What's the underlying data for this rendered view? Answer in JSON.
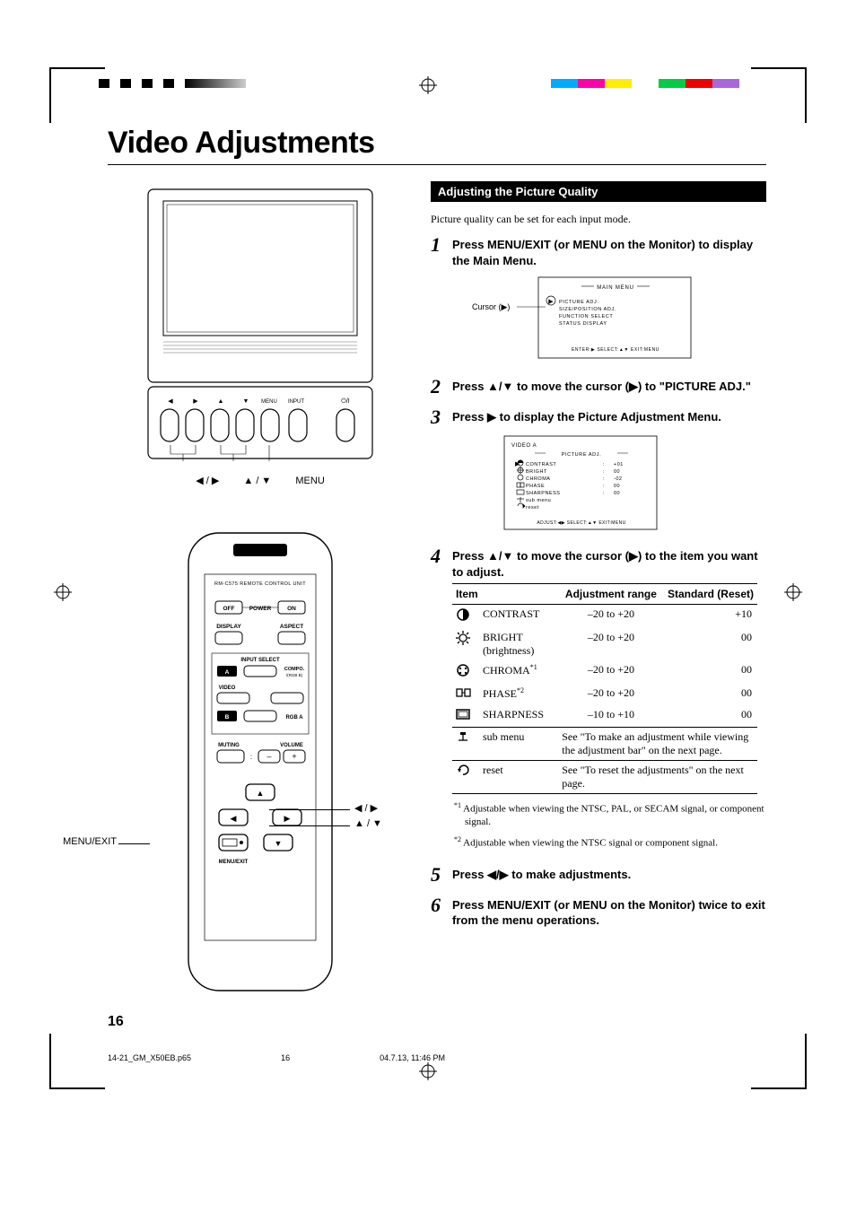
{
  "title": "Video Adjustments",
  "page_number": "16",
  "section_header": "Adjusting the Picture Quality",
  "intro": "Picture quality can be set for each input mode.",
  "monitor_button_row": [
    "◀",
    "▶",
    "▲",
    "▼",
    "MENU",
    "INPUT",
    "⏻/I"
  ],
  "monitor_labels": {
    "lr": "◀ / ▶",
    "ud": "▲ / ▼",
    "menu": "MENU"
  },
  "remote": {
    "model": "RM-C575 REMOTE CONTROL UNIT",
    "rows": {
      "power": [
        "OFF",
        "POWER",
        "ON"
      ],
      "disp": [
        "DISPLAY",
        "",
        "ASPECT"
      ],
      "inputselect_header": "INPUT SELECT",
      "inputselect1": [
        "A",
        "",
        "COMPO. /(RGB B)"
      ],
      "inputselect2": [
        "VIDEO",
        "",
        ""
      ],
      "inputselect3": [
        "B",
        "",
        "RGB A"
      ],
      "muting": [
        "MUTING",
        ":",
        "VOLUME"
      ],
      "vol": [
        "",
        "–",
        "+"
      ],
      "menuexit": "MENU/EXIT"
    },
    "leads": {
      "lr": "◀ / ▶",
      "ud": "▲ / ▼",
      "menuexit": "MENU/EXIT"
    }
  },
  "steps": [
    {
      "n": "1",
      "text": "Press MENU/EXIT (or MENU on the Monitor) to display the Main Menu."
    },
    {
      "n": "2",
      "text": "Press ▲/▼ to move the cursor (▶) to \"PICTURE ADJ.\""
    },
    {
      "n": "3",
      "text": "Press ▶ to display the Picture Adjustment Menu."
    },
    {
      "n": "4",
      "text": "Press ▲/▼ to move the cursor (▶) to the item you want to adjust."
    },
    {
      "n": "5",
      "text": "Press ◀/▶ to make adjustments."
    },
    {
      "n": "6",
      "text": "Press MENU/EXIT (or MENU on the Monitor) twice to exit from the menu operations."
    }
  ],
  "main_menu": {
    "cursor_label": "Cursor (▶)",
    "title": "MAIN MENU",
    "items": [
      "PICTURE ADJ.",
      "SIZE/POSITION ADJ.",
      "FUNCTION SELECT",
      "STATUS DISPLAY"
    ],
    "footer": "ENTER:▶  SELECT:▲▼  EXIT:MENU"
  },
  "picture_menu": {
    "header": "VIDEO A",
    "title": "PICTURE ADJ.",
    "rows": [
      [
        "CONTRAST",
        "+01"
      ],
      [
        "BRIGHT",
        "00"
      ],
      [
        "CHROMA",
        "-02"
      ],
      [
        "PHASE",
        "00"
      ],
      [
        "SHARPNESS",
        "00"
      ],
      [
        "sub menu",
        ""
      ],
      [
        "reset",
        ""
      ]
    ],
    "footer": "ADJUST:◀▶ SELECT:▲▼  EXIT:MENU"
  },
  "table": {
    "headers": [
      "Item",
      "Adjustment range",
      "Standard (Reset)"
    ],
    "rows": [
      {
        "icon": "contrast",
        "item": "CONTRAST",
        "range": "–20 to +20",
        "std": "+10"
      },
      {
        "icon": "bright",
        "item": "BRIGHT (brightness)",
        "range": "–20 to +20",
        "std": "00"
      },
      {
        "icon": "chroma",
        "item": "CHROMA",
        "sup": "*1",
        "range": "–20 to +20",
        "std": "00"
      },
      {
        "icon": "phase",
        "item": "PHASE",
        "sup": "*2",
        "range": "–20 to +20",
        "std": "00"
      },
      {
        "icon": "sharp",
        "item": "SHARPNESS",
        "range": "–10 to +10",
        "std": "00"
      }
    ],
    "sub_menu": {
      "label": "sub menu",
      "text": "See \"To make an adjustment while viewing the adjustment bar\" on the next page."
    },
    "reset": {
      "label": "reset",
      "text": "See \"To reset the adjustments\" on the next page."
    }
  },
  "footnotes": [
    "Adjustable when viewing the NTSC, PAL, or SECAM signal, or component signal.",
    "Adjustable when viewing the NTSC signal or component signal."
  ],
  "footer": {
    "file": "14-21_GM_X50EB.p65",
    "pg": "16",
    "ts": "04.7.13, 11:46 PM"
  }
}
